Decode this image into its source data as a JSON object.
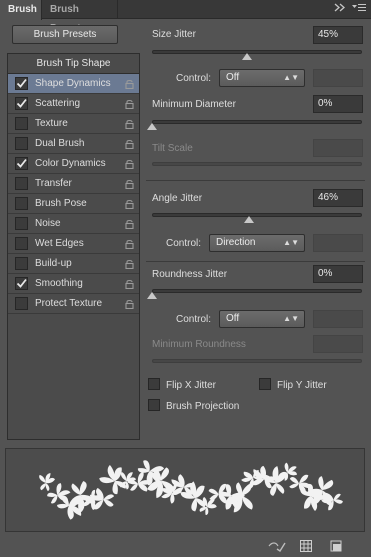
{
  "tabs": [
    {
      "label": "Brush"
    },
    {
      "label": "Brush Presets"
    }
  ],
  "tab_icons": [
    "double-arrow-icon",
    "panel-menu-icon"
  ],
  "brush_presets_button": "Brush Presets",
  "left_panel": {
    "header": "Brush Tip Shape",
    "items": [
      {
        "label": "Shape Dynamics",
        "checked": true,
        "selected": true
      },
      {
        "label": "Scattering",
        "checked": true,
        "selected": false
      },
      {
        "label": "Texture",
        "checked": false,
        "selected": false
      },
      {
        "label": "Dual Brush",
        "checked": false,
        "selected": false
      },
      {
        "label": "Color Dynamics",
        "checked": true,
        "selected": false
      },
      {
        "label": "Transfer",
        "checked": false,
        "selected": false
      },
      {
        "label": "Brush Pose",
        "checked": false,
        "selected": false
      },
      {
        "label": "Noise",
        "checked": false,
        "selected": false
      },
      {
        "label": "Wet Edges",
        "checked": false,
        "selected": false
      },
      {
        "label": "Build-up",
        "checked": false,
        "selected": false
      },
      {
        "label": "Smoothing",
        "checked": true,
        "selected": false
      },
      {
        "label": "Protect Texture",
        "checked": false,
        "selected": false
      }
    ]
  },
  "settings": {
    "size_jitter": {
      "label": "Size Jitter",
      "value": "45%",
      "level": 0.45
    },
    "size_control": {
      "label": "Control:",
      "value": "Off"
    },
    "minimum_diameter": {
      "label": "Minimum Diameter",
      "value": "0%",
      "level": 0
    },
    "tilt_scale": {
      "label": "Tilt Scale"
    },
    "angle_jitter": {
      "label": "Angle Jitter",
      "value": "46%",
      "level": 0.46
    },
    "angle_control": {
      "label": "Control:",
      "value": "Direction"
    },
    "roundness_jitter": {
      "label": "Roundness Jitter",
      "value": "0%",
      "level": 0
    },
    "roundness_control": {
      "label": "Control:",
      "value": "Off"
    },
    "minimum_roundness": {
      "label": "Minimum Roundness"
    },
    "flip_x": {
      "label": "Flip X Jitter",
      "checked": false
    },
    "flip_y": {
      "label": "Flip Y Jitter",
      "checked": false
    },
    "brush_projection": {
      "label": "Brush Projection",
      "checked": false
    }
  },
  "footer_icons": [
    "toggle-live-tip-icon",
    "grid-icon",
    "new-preset-icon"
  ],
  "colors": {
    "panel_bg": "#535353",
    "selected_row": "#6b7a93",
    "tab_bar": "#383838"
  }
}
